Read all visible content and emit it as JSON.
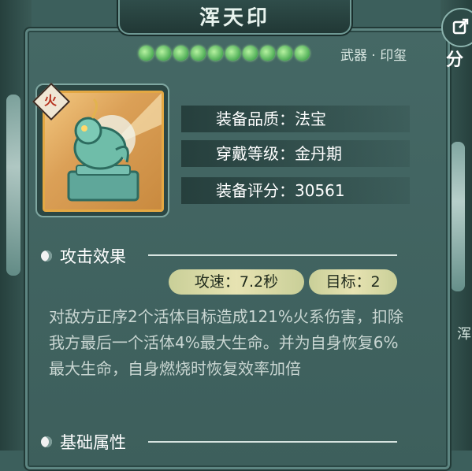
{
  "header": {
    "title": "浑天印"
  },
  "stars": {
    "count": 10,
    "color": "#5fc45a"
  },
  "item": {
    "type": "武器 · 印玺",
    "element": "火",
    "quality_label": "装备品质：法宝",
    "level_label": "穿戴等级：金丹期",
    "score_label": "装备评分：30561"
  },
  "share": {
    "label": "分"
  },
  "attack_section": {
    "heading": "攻击效果",
    "speed": "攻速：7.2秒",
    "targets": "目标：2",
    "description": "对敌方正序2个活体目标造成121%火系伤害，扣除我方最后一个活体4%最大生命。并为自身恢复6%最大生命，自身燃烧时恢复效率加倍"
  },
  "base_section": {
    "heading": "基础属性"
  },
  "side_text": {
    "right": "浑"
  },
  "colors": {
    "panel": "#456865",
    "accent_gold": "#e4a843",
    "pill": "#e7e3b2"
  }
}
